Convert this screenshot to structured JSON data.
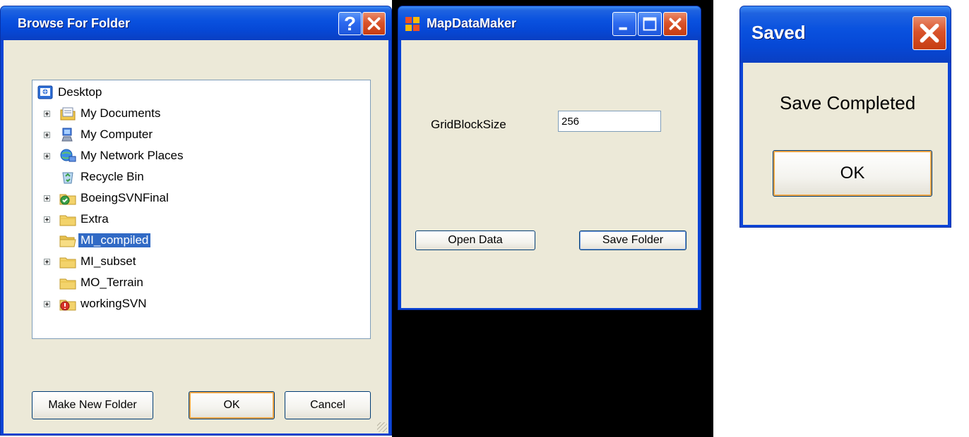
{
  "browse_dialog": {
    "title": "Browse For Folder",
    "tree": [
      {
        "label": "Desktop",
        "icon": "desktop-icon",
        "level": 0,
        "expandable": false,
        "selected": false
      },
      {
        "label": "My Documents",
        "icon": "my-documents-icon",
        "level": 1,
        "expandable": true,
        "selected": false
      },
      {
        "label": "My Computer",
        "icon": "my-computer-icon",
        "level": 1,
        "expandable": true,
        "selected": false
      },
      {
        "label": "My Network Places",
        "icon": "network-places-icon",
        "level": 1,
        "expandable": true,
        "selected": false
      },
      {
        "label": "Recycle Bin",
        "icon": "recycle-bin-icon",
        "level": 1,
        "expandable": false,
        "selected": false
      },
      {
        "label": "BoeingSVNFinal",
        "icon": "svn-folder-icon",
        "level": 1,
        "expandable": true,
        "selected": false
      },
      {
        "label": "Extra",
        "icon": "folder-icon",
        "level": 1,
        "expandable": true,
        "selected": false
      },
      {
        "label": "MI_compiled",
        "icon": "open-folder-icon",
        "level": 1,
        "expandable": false,
        "selected": true
      },
      {
        "label": "MI_subset",
        "icon": "folder-icon",
        "level": 1,
        "expandable": true,
        "selected": false
      },
      {
        "label": "MO_Terrain",
        "icon": "folder-icon",
        "level": 1,
        "expandable": false,
        "selected": false
      },
      {
        "label": "workingSVN",
        "icon": "svn-modified-folder-icon",
        "level": 1,
        "expandable": true,
        "selected": false
      }
    ],
    "buttons": {
      "make_new_folder": "Make New Folder",
      "ok": "OK",
      "cancel": "Cancel"
    }
  },
  "map_data_maker": {
    "title": "MapDataMaker",
    "grid_block_size_label": "GridBlockSize",
    "grid_block_size_value": "256",
    "open_data_button": "Open Data",
    "save_folder_button": "Save Folder"
  },
  "saved_dialog": {
    "title": "Saved",
    "message": "Save Completed",
    "ok_button": "OK"
  },
  "colors": {
    "titlebar_blue": "#0a52df",
    "dialog_face": "#ece9d8",
    "close_red": "#d9532b",
    "selection_blue": "#316ac5",
    "default_button_glow": "#f0a646"
  }
}
